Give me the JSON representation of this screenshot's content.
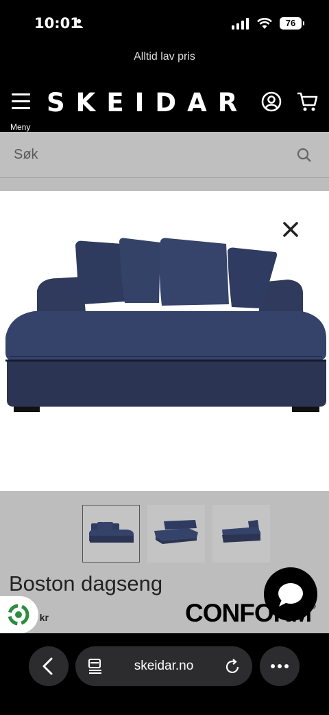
{
  "status_bar": {
    "time": "10:01",
    "battery": "76"
  },
  "promo": {
    "text": "Alltid lav pris"
  },
  "header": {
    "menu_label": "Meny",
    "logo": "SKEIDAR"
  },
  "search": {
    "placeholder": "Søk"
  },
  "product": {
    "title": "Boston dagseng",
    "price_visible_fragment": "9 kr",
    "brand": "CONFORM",
    "brand_mark": "®"
  },
  "gallery": {
    "thumbnails": [
      "front",
      "angle",
      "side"
    ],
    "active_index": 0
  },
  "browser": {
    "url": "skeidar.no"
  },
  "colors": {
    "sofa": "#2a3452",
    "background": "#000000",
    "dim": "#bdbdbd"
  }
}
